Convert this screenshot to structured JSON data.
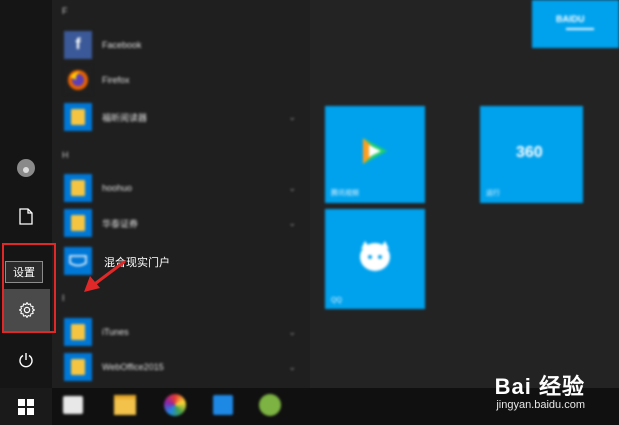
{
  "rail": {
    "tooltip": "设置"
  },
  "apps": {
    "letter_f": "F",
    "letter_h": "H",
    "letter_i": "I",
    "items": [
      {
        "label": "Facebook"
      },
      {
        "label": "Firefox"
      },
      {
        "label": "福昕阅读器"
      },
      {
        "label": "hoohuo"
      },
      {
        "label": "华泰证券"
      },
      {
        "label": "混合现实门户"
      },
      {
        "label": "iTunes"
      },
      {
        "label": "WebOffice2015"
      }
    ]
  },
  "tiles": {
    "baidu": "BAIDU",
    "t1": "腾讯视频",
    "t2": "360",
    "t3": "运行",
    "t4": "QQ"
  },
  "watermark": {
    "brand": "Bai 经验",
    "url": "jingyan.baidu.com"
  },
  "colors": {
    "tile_blue": "#00a2ed",
    "highlight_red": "#e02828"
  }
}
